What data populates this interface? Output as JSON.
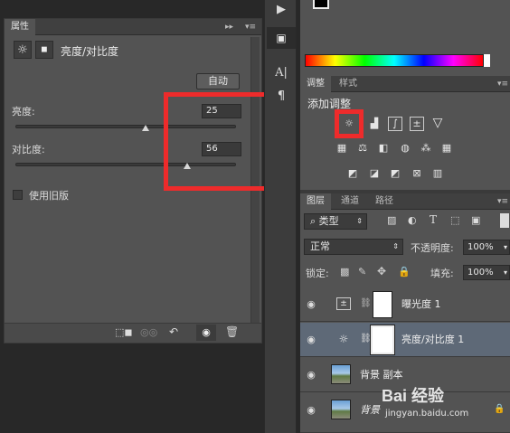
{
  "properties": {
    "tab_label": "属性",
    "header_title": "亮度/对比度",
    "auto_button": "自动",
    "brightness": {
      "label": "亮度:",
      "value": "25",
      "slider_fraction": 0.59
    },
    "contrast": {
      "label": "对比度:",
      "value": "56",
      "slider_fraction": 0.78
    },
    "legacy_checkbox_label": "使用旧版",
    "legacy_checked": false
  },
  "color_panel": {
    "swatch_color": "#000000"
  },
  "adjustments": {
    "tabs": [
      "调整",
      "样式"
    ],
    "add_label": "添加调整",
    "icon_rows": [
      [
        "brightness-contrast-icon",
        "levels-icon",
        "curves-icon",
        "exposure-icon",
        "vibrance-icon"
      ],
      [
        "hue-saturation-icon",
        "color-balance-icon",
        "black-white-icon",
        "photo-filter-icon",
        "channel-mixer-icon",
        "color-lookup-icon"
      ],
      [
        "invert-icon",
        "posterize-icon",
        "threshold-icon",
        "selective-color-icon",
        "gradient-map-icon"
      ]
    ]
  },
  "layers_panel": {
    "tabs": [
      "图层",
      "通道",
      "路径"
    ],
    "filter_kind": "类型",
    "blend_mode": "正常",
    "opacity_label": "不透明度:",
    "opacity_value": "100%",
    "lock_label": "锁定:",
    "fill_label": "填充:",
    "fill_value": "100%",
    "layers": [
      {
        "name": "曝光度 1",
        "kind": "adjustment",
        "selected": false
      },
      {
        "name": "亮度/对比度 1",
        "kind": "adjustment",
        "selected": true
      },
      {
        "name": "背景 副本",
        "kind": "image",
        "selected": false
      },
      {
        "name": "背景",
        "kind": "image",
        "selected": false,
        "locked": true
      }
    ]
  },
  "watermark": {
    "brand": "Bai 经验",
    "url": "jingyan.baidu.com"
  }
}
